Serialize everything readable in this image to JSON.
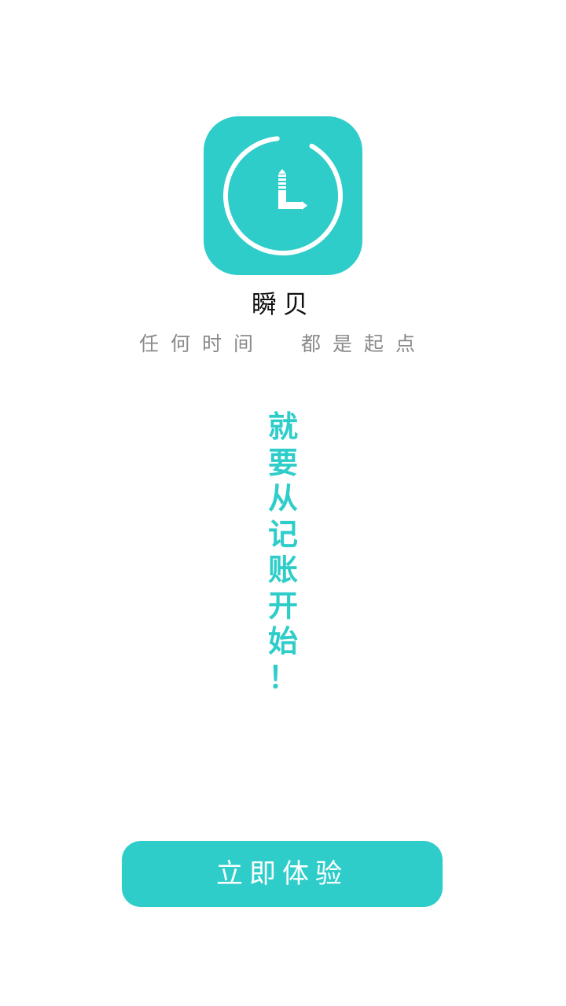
{
  "app": {
    "name": "瞬贝",
    "slogan": "任何时间  都是起点",
    "tagline_chars": [
      "就",
      "要",
      "从",
      "记",
      "账",
      "开",
      "始",
      "！"
    ]
  },
  "cta": {
    "label": "立即体验"
  },
  "icon": {
    "name": "clock-icon"
  },
  "colors": {
    "accent": "#2ecdca",
    "background": "#ffffff",
    "title": "#111111",
    "slogan": "#8a8a8a",
    "button_text": "#ffffff"
  }
}
